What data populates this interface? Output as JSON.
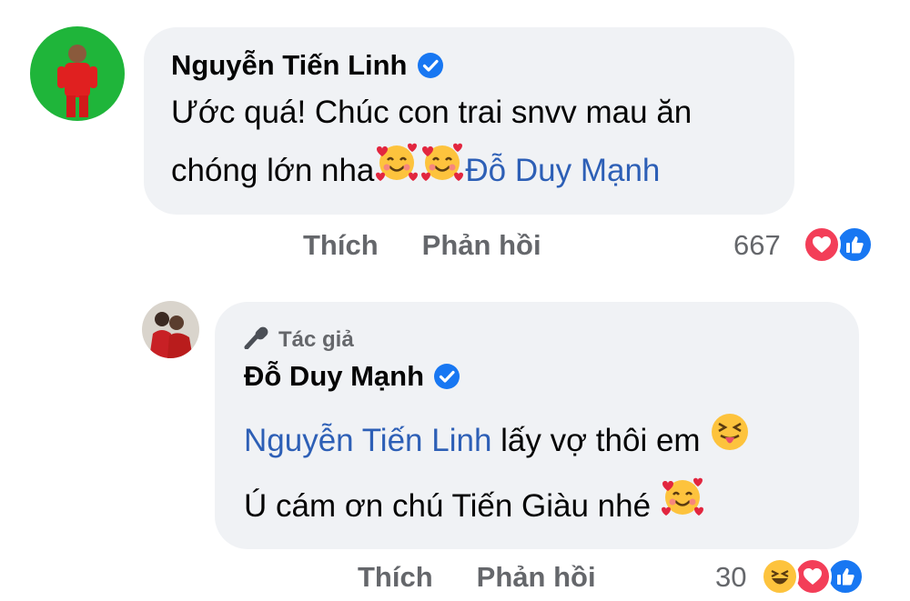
{
  "comment1": {
    "author": "Nguyễn Tiến Linh",
    "line1": "Ước quá! Chúc con trai snvv mau ăn",
    "line2_prefix": "chóng lớn nha",
    "mention": "Đỗ Duy Mạnh",
    "emojis": [
      "smiling-face-with-hearts",
      "smiling-face-with-hearts"
    ],
    "actions": {
      "like": "Thích",
      "reply": "Phản hồi"
    },
    "reaction_count": "667",
    "reactions": [
      "love",
      "like"
    ]
  },
  "comment2": {
    "badge": "Tác giả",
    "author": "Đỗ Duy Mạnh",
    "mention": "Nguyễn Tiến Linh",
    "line1_suffix": "lấy vợ thôi em",
    "line2": "Ú cám ơn chú Tiến Giàu nhé",
    "emojis": [
      "squinting-face-with-tongue",
      "smiling-face-with-hearts"
    ],
    "actions": {
      "like": "Thích",
      "reply": "Phản hồi"
    },
    "reaction_count": "30",
    "reactions": [
      "haha",
      "love",
      "like"
    ]
  },
  "colors": {
    "bubble": "#f0f2f5",
    "mention": "#2d5fb6",
    "muted": "#65676b",
    "like": "#1877f2",
    "love": "#f33e58",
    "verified": "#1877f2"
  }
}
